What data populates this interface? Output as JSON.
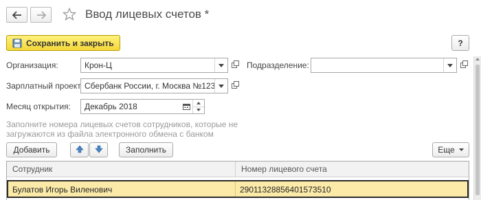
{
  "window": {
    "title": "Ввод лицевых счетов *"
  },
  "toolbar": {
    "save_close_label": "Сохранить и закрыть",
    "help_label": "?"
  },
  "form": {
    "organization": {
      "label": "Организация:",
      "value": "Крон-Ц"
    },
    "department": {
      "label": "Подразделение:",
      "value": ""
    },
    "salary_project": {
      "label": "Зарплатный проект:",
      "value": "Сбербанк России, г. Москва №123"
    },
    "open_month": {
      "label": "Месяц открытия:",
      "value": "Декабрь 2018"
    },
    "hint_line1": "Заполните номера лицевых счетов сотрудников, которые не",
    "hint_line2": "загружаются из файла электронного обмена с банком"
  },
  "table_toolbar": {
    "add_label": "Добавить",
    "fill_label": "Заполнить",
    "more_label": "Еще"
  },
  "table": {
    "columns": [
      "Сотрудник",
      "Номер лицевого счета"
    ],
    "rows": [
      {
        "employee": "Булатов Игорь Виленович",
        "account": "29011328856401573510"
      }
    ]
  },
  "icons": {
    "back": "arrow-left-icon",
    "forward": "arrow-right-icon",
    "favorite": "star-icon",
    "save": "floppy-disk-icon",
    "dropdown": "chevron-down-icon",
    "open": "open-form-icon",
    "calendar": "calendar-icon",
    "move_up": "arrow-up-icon",
    "move_down": "arrow-down-icon"
  },
  "colors": {
    "primary_button": "#f5d73a",
    "selected_row": "#fbeaa8",
    "nav_arrow_blue": "#4a86c5"
  }
}
